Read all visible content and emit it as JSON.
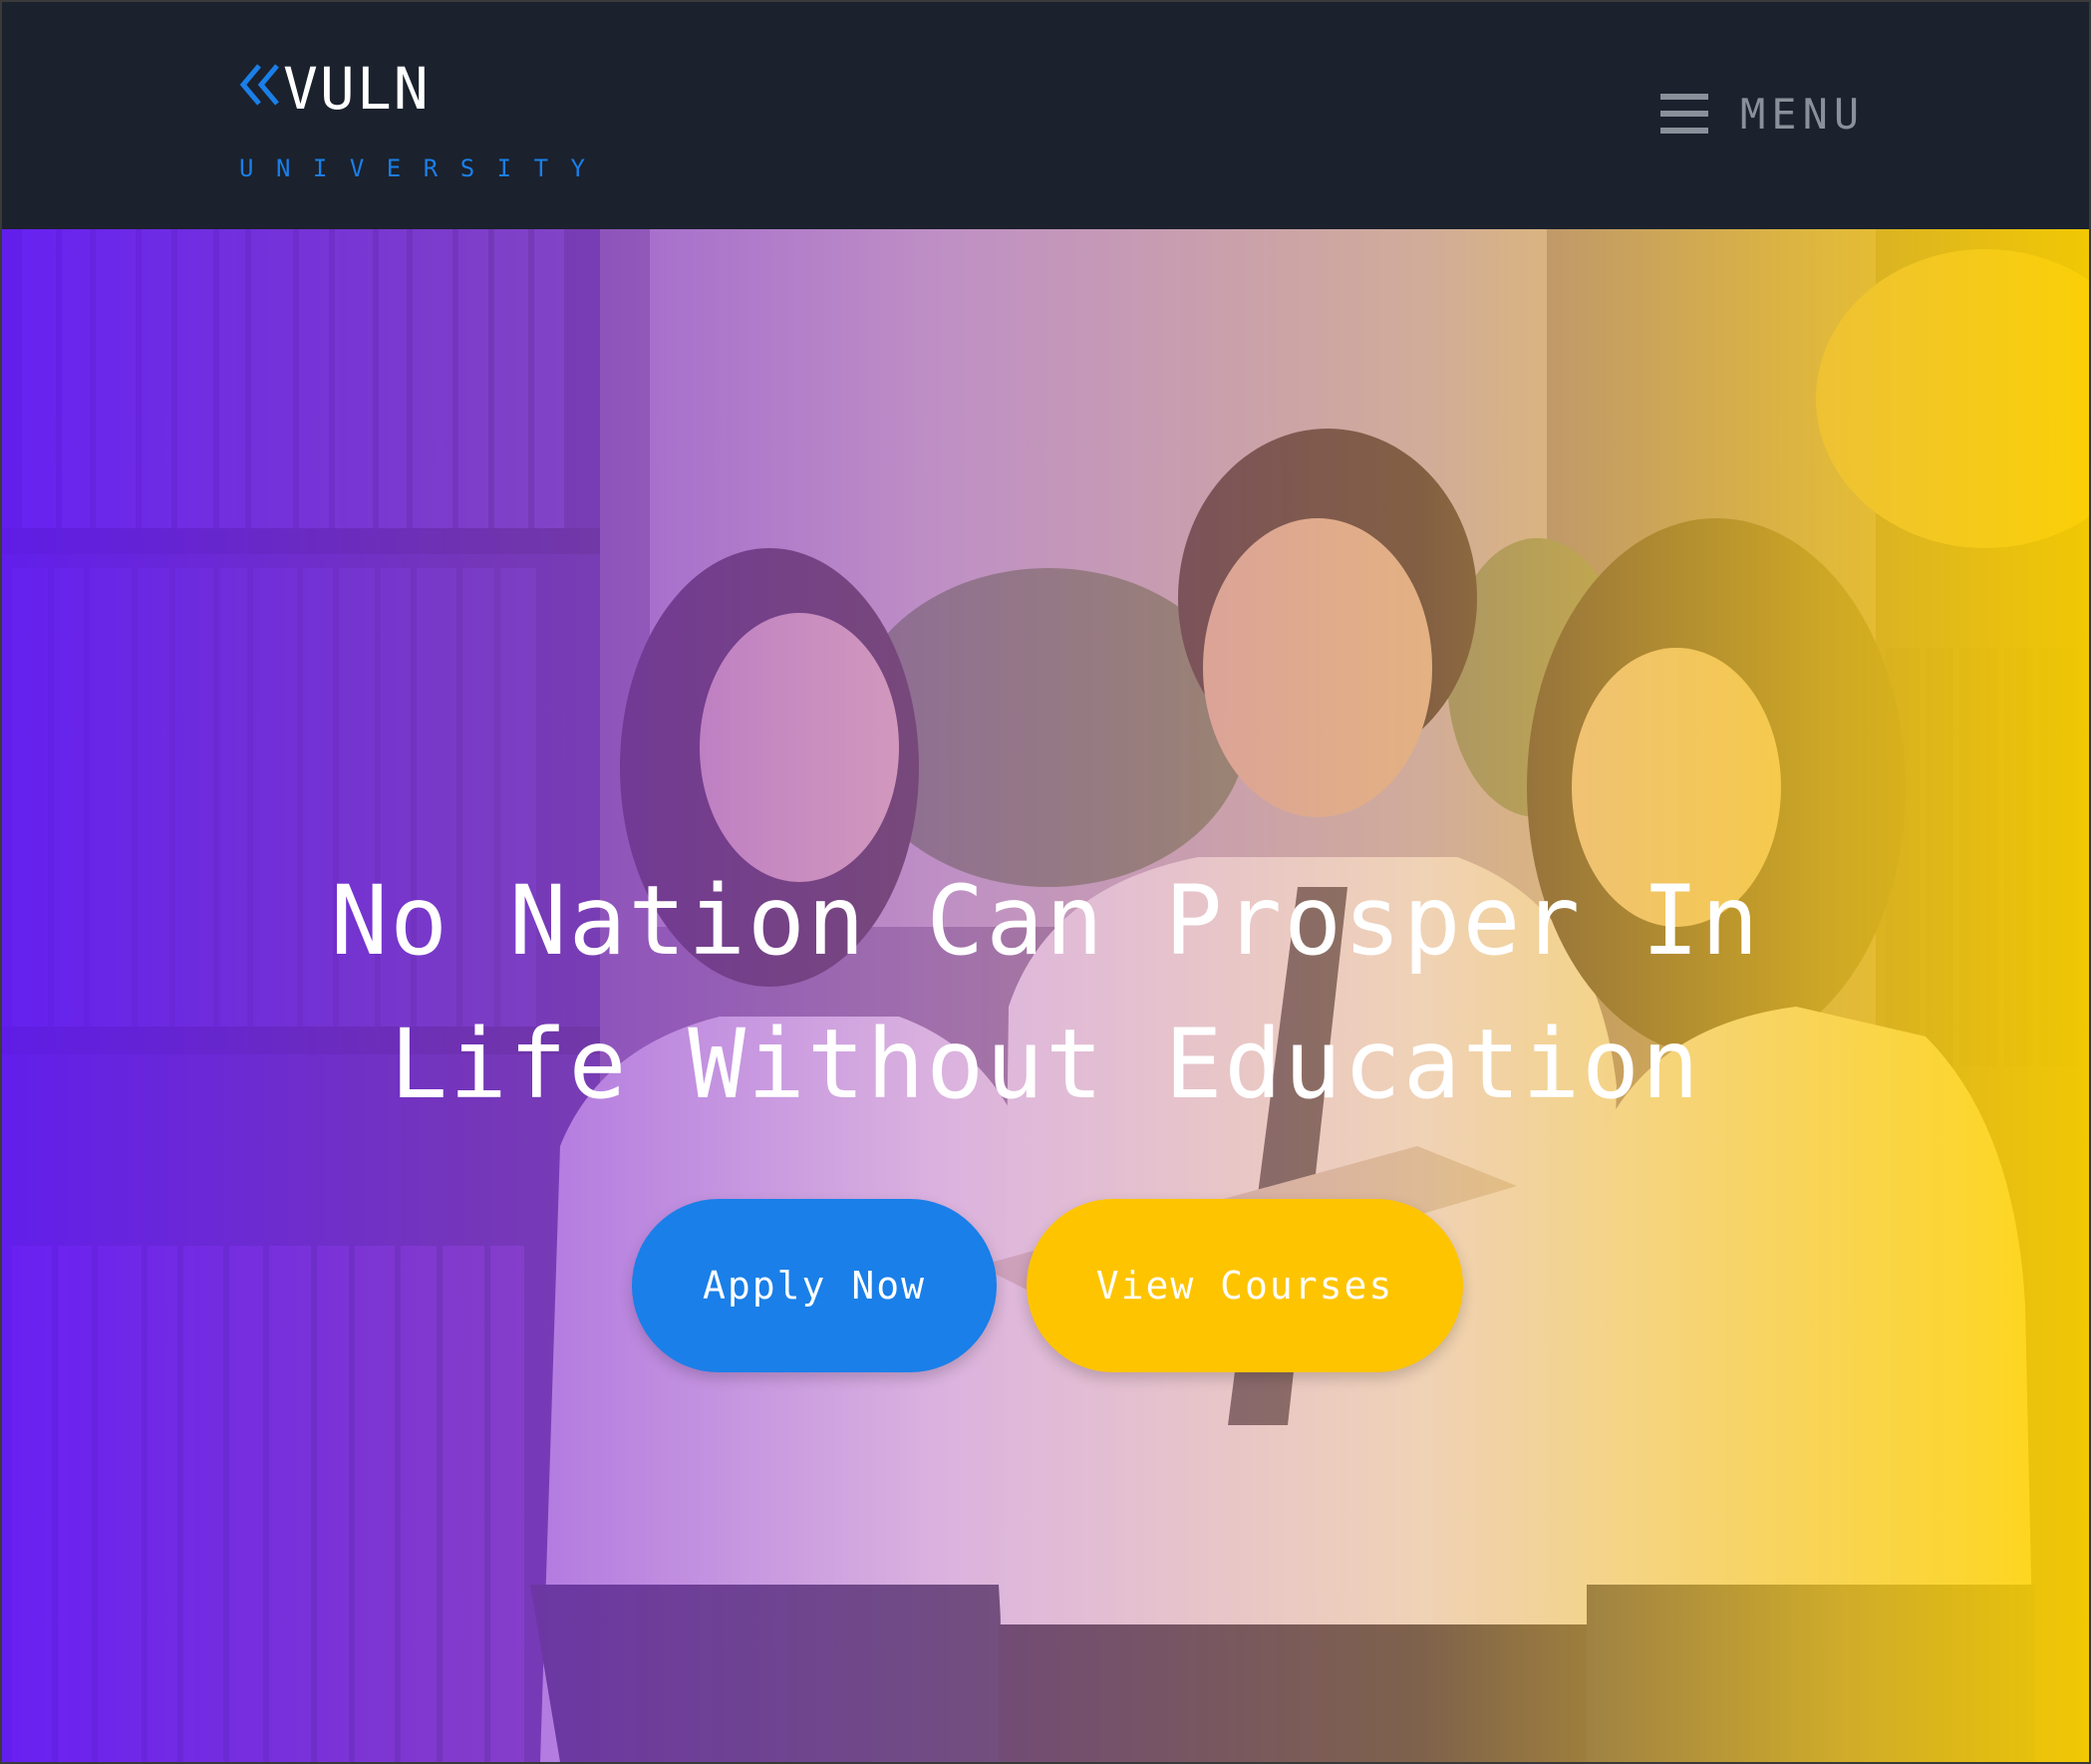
{
  "header": {
    "brand_name": "VULN",
    "brand_tagline": "UNIVERSITY",
    "menu_label": "MENU"
  },
  "hero": {
    "headline_line1": "No Nation Can Prosper In",
    "headline_line2": "Life Without Education",
    "apply_label": "Apply Now",
    "courses_label": "View Courses"
  },
  "colors": {
    "nav_background": "#1b212d",
    "brand_accent": "#1a7fe8",
    "apply_button": "#1a7fe8",
    "courses_button": "#ffc400",
    "gradient_left": "#681cff",
    "gradient_right": "#ffd400",
    "menu_text": "#8a9099"
  },
  "icons": {
    "brand_mark": "double-chevron-left-icon",
    "menu": "hamburger-icon"
  }
}
